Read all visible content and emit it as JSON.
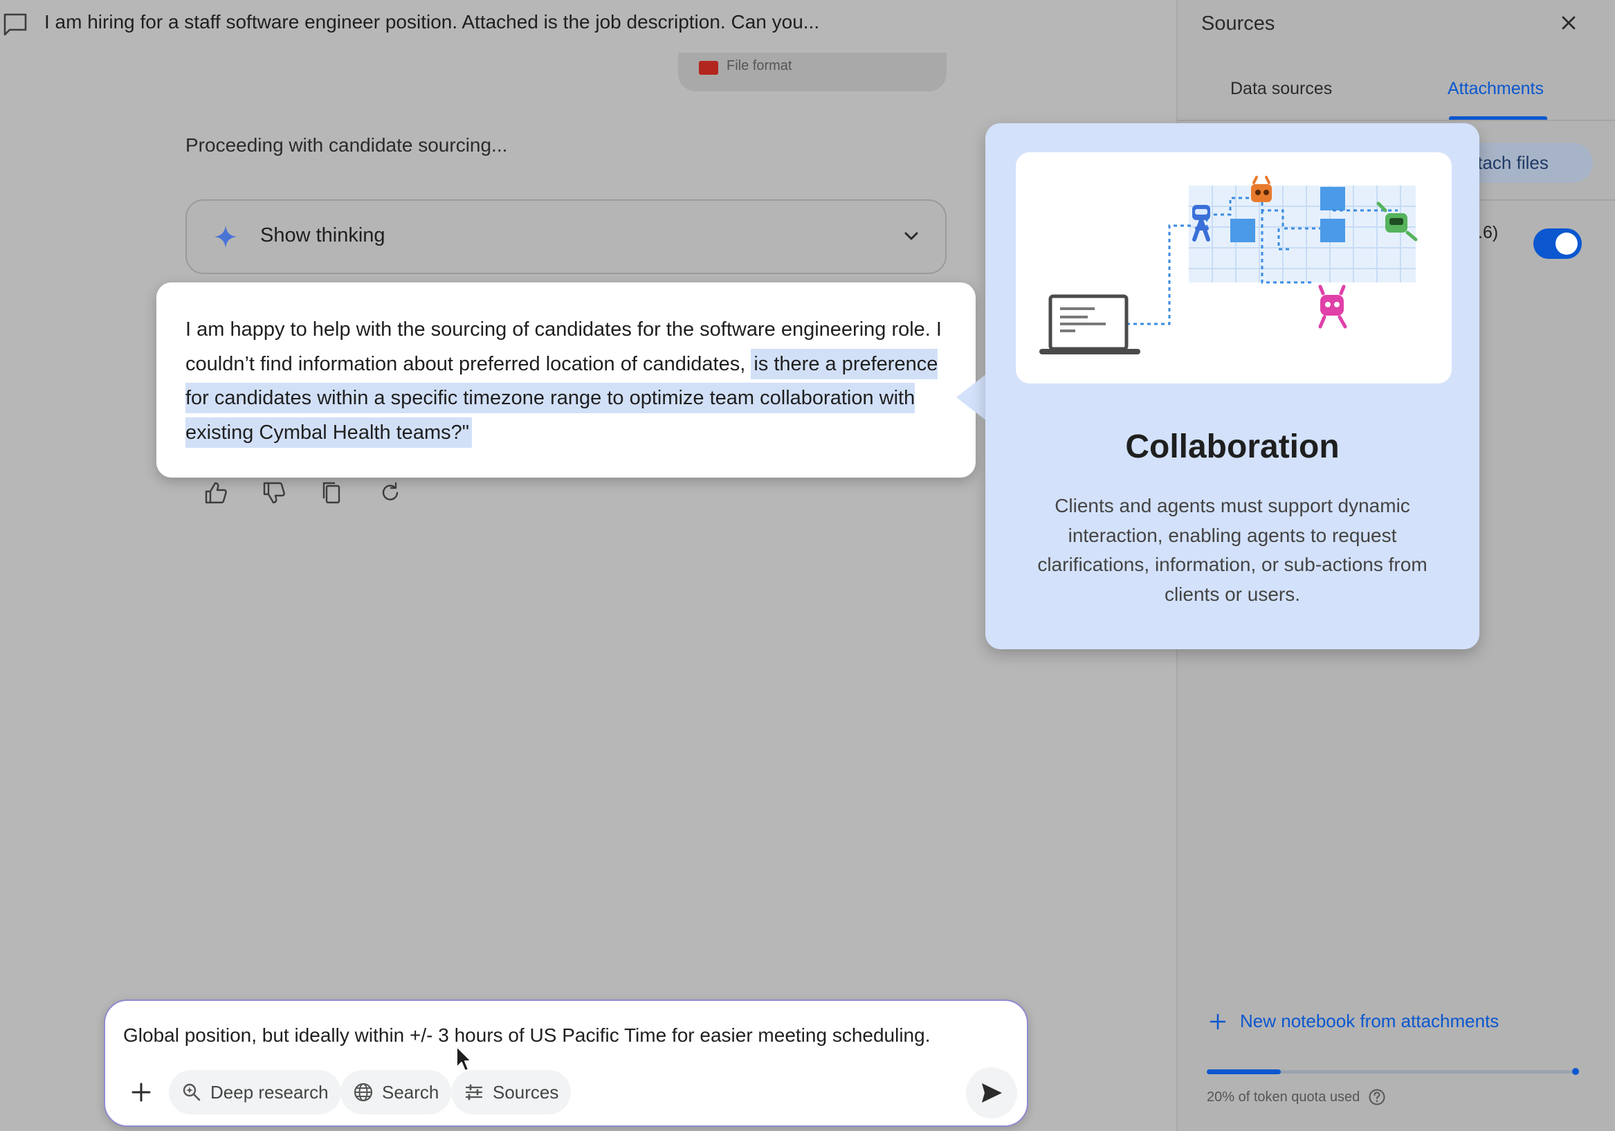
{
  "chat": {
    "title": "I am hiring for a staff software engineer position. Attached is the job description. Can you...",
    "file_chip_label": "File format",
    "status": "Proceeding with candidate sourcing...",
    "thinking_label": "Show thinking",
    "response_plain": "I am happy to help with the sourcing of candidates for the software engineering role. I couldn’t find information about preferred location of candidates,",
    "response_highlight": "is there a preference for candidates within a specific timezone range to optimize team collaboration with existing Cymbal Health teams?\""
  },
  "actions": [
    "thumbs-up-icon",
    "thumbs-down-icon",
    "copy-icon",
    "refresh-icon"
  ],
  "composer": {
    "input_value": "Global position, but ideally within +/- 3 hours of US Pacific Time for easier meeting scheduling.",
    "tools": {
      "deep_research": "Deep research",
      "search": "Search",
      "sources": "Sources"
    }
  },
  "panel": {
    "title": "Sources",
    "tabs": {
      "data_sources": "Data sources",
      "attachments": "Attachments"
    },
    "attach_button": "ttach files",
    "row_fragment": ".6)",
    "toggle_on": true,
    "new_notebook": "New notebook from attachments",
    "quota_fraction": 0.2,
    "quota_text": "20% of token quota used"
  },
  "card": {
    "title": "Collaboration",
    "body": "Clients and agents must support dynamic interaction, enabling agents to request clarifications, information, or sub-actions from clients or users."
  },
  "colors": {
    "accent": "#0b57d0",
    "highlight": "#d2e0f7",
    "card_bg": "#d3e1fa",
    "overlay": "#b7b7b7"
  }
}
